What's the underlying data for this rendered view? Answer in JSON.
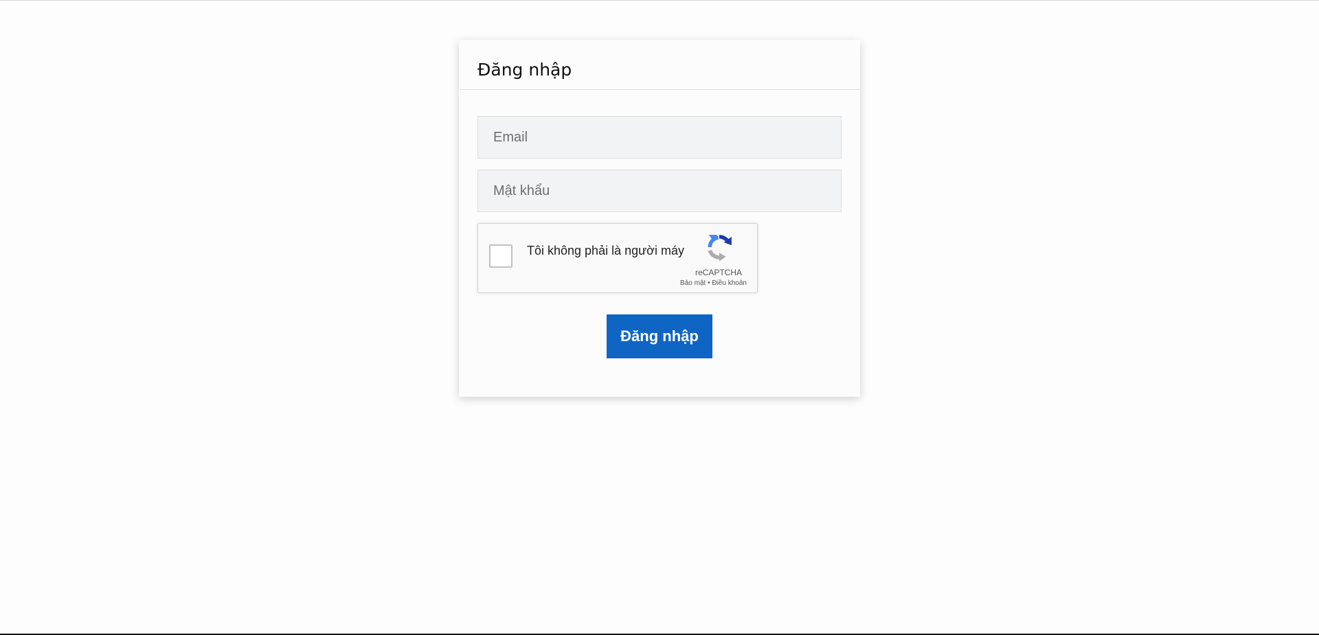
{
  "login": {
    "title": "Đăng nhập",
    "email_placeholder": "Email",
    "password_placeholder": "Mật khẩu",
    "submit_label": "Đăng nhập"
  },
  "recaptcha": {
    "label": "Tôi không phải là người máy",
    "brand": "reCAPTCHA",
    "privacy_label": "Bảo mật",
    "separator": " • ",
    "terms_label": "Điều khoản",
    "logo_icon": "recaptcha-logo-icon"
  },
  "colors": {
    "primary_button": "#0e65c4",
    "input_background": "#f2f3f5",
    "page_background": "#fdfdfd"
  }
}
